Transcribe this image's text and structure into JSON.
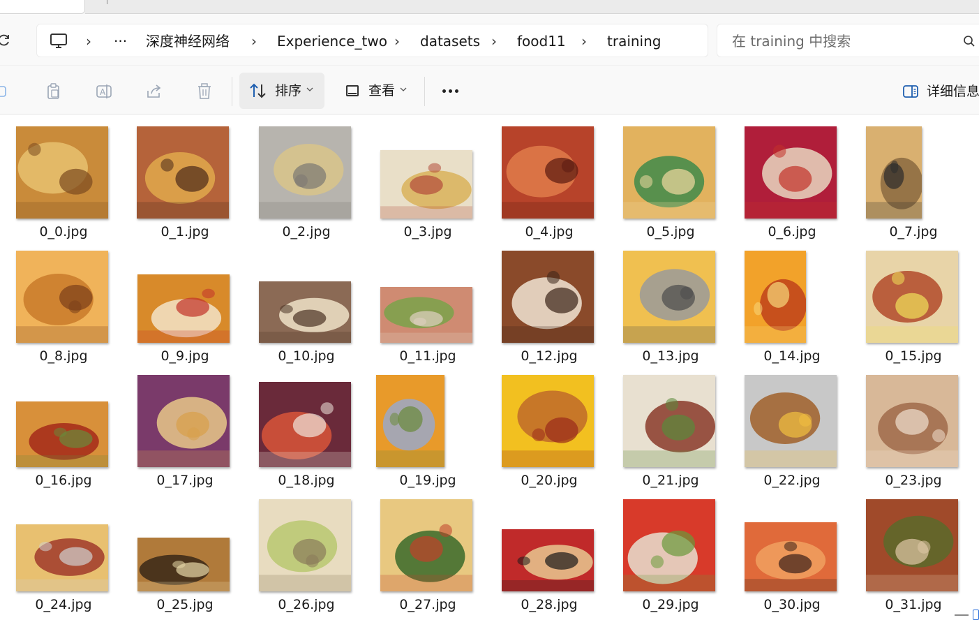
{
  "tabstrip": {
    "close_glyph": "✕"
  },
  "address_bar": {
    "refresh_icon": "refresh-icon",
    "pc_icon": "monitor-icon",
    "overflow_label": "···",
    "breadcrumb": [
      "深度神经网络",
      "Experience_two",
      "datasets",
      "food11",
      "training"
    ],
    "separator": "›"
  },
  "search": {
    "placeholder": "在 training 中搜索",
    "icon": "search-icon"
  },
  "toolbar": {
    "icons": [
      "new-icon",
      "paste-icon",
      "rename-icon",
      "share-icon",
      "delete-icon"
    ],
    "sort_label": "排序",
    "view_label": "查看",
    "details_label": "详细信息"
  },
  "files": [
    {
      "name": "0_0.jpg",
      "colors": [
        "#c98b3a",
        "#e8c170",
        "#7a4a1f"
      ]
    },
    {
      "name": "0_1.jpg",
      "colors": [
        "#b5633a",
        "#e0a84c",
        "#4b2a1a"
      ]
    },
    {
      "name": "0_2.jpg",
      "colors": [
        "#b7b4ae",
        "#d9c48a",
        "#7b7772"
      ]
    },
    {
      "name": "0_3.jpg",
      "colors": [
        "#e9dfc8",
        "#d9b35a",
        "#b24b3a"
      ]
    },
    {
      "name": "0_4.jpg",
      "colors": [
        "#b7432a",
        "#e07b4a",
        "#5a1a10"
      ]
    },
    {
      "name": "0_5.jpg",
      "colors": [
        "#e2b25e",
        "#3f8a4a",
        "#f1d9a0"
      ]
    },
    {
      "name": "0_6.jpg",
      "colors": [
        "#b01e3a",
        "#e9d7c1",
        "#c2322a"
      ]
    },
    {
      "name": "0_7.jpg",
      "colors": [
        "#d9b070",
        "#8a6a3f",
        "#2b2b2b"
      ]
    },
    {
      "name": "0_8.jpg",
      "colors": [
        "#f0b35a",
        "#c97a2a",
        "#7a3f1a"
      ]
    },
    {
      "name": "0_9.jpg",
      "colors": [
        "#d88a2a",
        "#f3e3c8",
        "#c2322a"
      ]
    },
    {
      "name": "0_10.jpg",
      "colors": [
        "#8b6a55",
        "#efe2c8",
        "#4b3325"
      ]
    },
    {
      "name": "0_11.jpg",
      "colors": [
        "#cf8b72",
        "#7aa24a",
        "#e0d2c2"
      ]
    },
    {
      "name": "0_12.jpg",
      "colors": [
        "#8a4a2a",
        "#f0e4d4",
        "#3a2418"
      ]
    },
    {
      "name": "0_13.jpg",
      "colors": [
        "#f0c050",
        "#9a9a9a",
        "#4a4a4a"
      ]
    },
    {
      "name": "0_14.jpg",
      "colors": [
        "#f2a22a",
        "#c0421a",
        "#f7d77a"
      ]
    },
    {
      "name": "0_15.jpg",
      "colors": [
        "#e8d4a8",
        "#b24a2a",
        "#f1e15a"
      ]
    },
    {
      "name": "0_16.jpg",
      "colors": [
        "#d8903a",
        "#a42a1a",
        "#6a8a3a"
      ]
    },
    {
      "name": "0_17.jpg",
      "colors": [
        "#7a3a6a",
        "#e8c888",
        "#d9a04a"
      ]
    },
    {
      "name": "0_18.jpg",
      "colors": [
        "#6a2a3a",
        "#d8553a",
        "#efe6dc"
      ]
    },
    {
      "name": "0_19.jpg",
      "colors": [
        "#e89a2a",
        "#9aa8c8",
        "#6a8a3a"
      ]
    },
    {
      "name": "0_20.jpg",
      "colors": [
        "#f2c020",
        "#c06a2a",
        "#9a2a1a"
      ]
    },
    {
      "name": "0_21.jpg",
      "colors": [
        "#e8e0d0",
        "#8a3a2a",
        "#5a8a3a"
      ]
    },
    {
      "name": "0_22.jpg",
      "colors": [
        "#c8c8c8",
        "#a0602a",
        "#f2c040"
      ]
    },
    {
      "name": "0_23.jpg",
      "colors": [
        "#d8b898",
        "#a06a4a",
        "#f0e0d0"
      ]
    },
    {
      "name": "0_24.jpg",
      "colors": [
        "#e8c070",
        "#a03a2a",
        "#d0d0d0"
      ]
    },
    {
      "name": "0_25.jpg",
      "colors": [
        "#b07a3a",
        "#3a2818",
        "#e8d8a8"
      ]
    },
    {
      "name": "0_26.jpg",
      "colors": [
        "#e8dcc0",
        "#b8c870",
        "#8a7a5a"
      ]
    },
    {
      "name": "0_27.jpg",
      "colors": [
        "#e8c880",
        "#3a6a2a",
        "#c0402a"
      ]
    },
    {
      "name": "0_28.jpg",
      "colors": [
        "#c02a2a",
        "#e8c890",
        "#1a1a1a"
      ]
    },
    {
      "name": "0_29.jpg",
      "colors": [
        "#d83a2a",
        "#e8e0d0",
        "#6a9a3a"
      ]
    },
    {
      "name": "0_30.jpg",
      "colors": [
        "#e06a3a",
        "#f0a060",
        "#3a2018"
      ]
    },
    {
      "name": "0_31.jpg",
      "colors": [
        "#a04a2a",
        "#5a6a2a",
        "#e0c8a8"
      ]
    }
  ]
}
